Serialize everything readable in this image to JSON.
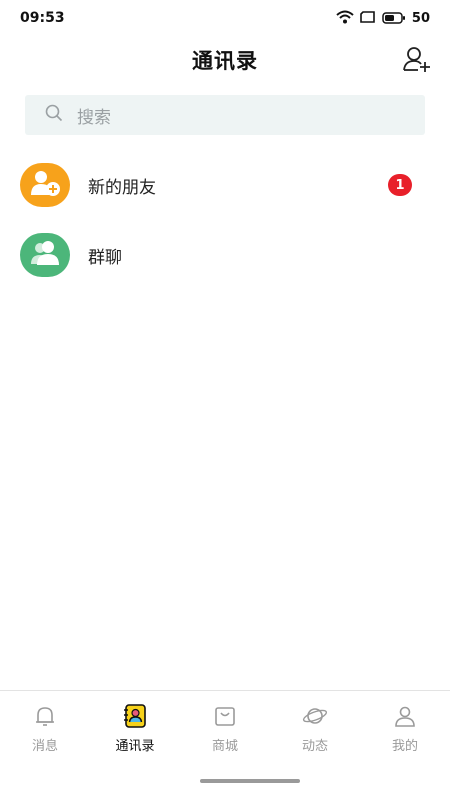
{
  "status_bar": {
    "time": "09:53",
    "battery": "50"
  },
  "header": {
    "title": "通讯录"
  },
  "search": {
    "placeholder": "搜索"
  },
  "contacts": [
    {
      "label": "新的朋友",
      "badge": "1"
    },
    {
      "label": "群聊"
    }
  ],
  "tabs": [
    {
      "label": "消息"
    },
    {
      "label": "通讯录"
    },
    {
      "label": "商城"
    },
    {
      "label": "动态"
    },
    {
      "label": "我的"
    }
  ],
  "colors": {
    "new_friends_avatar": "#f7a21b",
    "group_chat_avatar": "#4cb67a",
    "badge": "#e8202a",
    "search_bg": "#eef4f4"
  }
}
